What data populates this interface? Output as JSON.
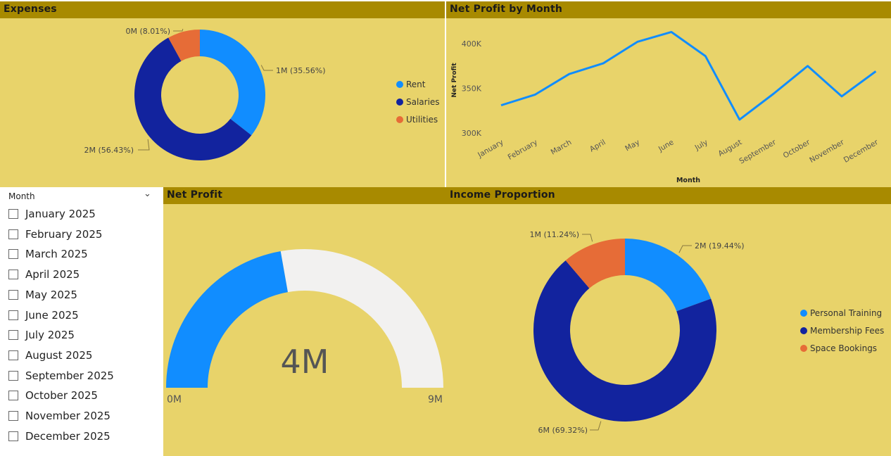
{
  "expenses": {
    "title": "Expenses",
    "legend": [
      "Rent",
      "Salaries",
      "Utilities"
    ],
    "slice_labels": [
      "1M (35.56%)",
      "2M (56.43%)",
      "0M (8.01%)"
    ]
  },
  "net_profit_by_month": {
    "title": "Net Profit by Month",
    "xlabel": "Month",
    "ylabel": "Net Profit",
    "yticks": [
      "400K",
      "350K",
      "300K"
    ],
    "months": [
      "January",
      "February",
      "March",
      "April",
      "May",
      "June",
      "July",
      "August",
      "September",
      "October",
      "November",
      "December"
    ]
  },
  "net_profit_gauge": {
    "title": "Net Profit",
    "value_label": "4M",
    "min_label": "0M",
    "max_label": "9M"
  },
  "income_proportion": {
    "title": "Income Proportion",
    "legend": [
      "Personal Training",
      "Membership Fees",
      "Space Bookings"
    ],
    "slice_labels": [
      "2M (19.44%)",
      "6M (69.32%)",
      "1M (11.24%)"
    ]
  },
  "slicer": {
    "title": "Month",
    "items": [
      "January 2025",
      "February 2025",
      "March 2025",
      "April 2025",
      "May 2025",
      "June 2025",
      "July 2025",
      "August 2025",
      "September 2025",
      "October 2025",
      "November 2025",
      "December 2025"
    ]
  },
  "colors": {
    "rent": "#118dff",
    "salaries": "#12239e",
    "utilities": "#e66c37",
    "panel_bg": "#e8d36a",
    "header_bg": "#a88a00",
    "gauge_empty": "#f2f1f0"
  },
  "chart_data": [
    {
      "type": "pie",
      "title": "Expenses",
      "categories": [
        "Rent",
        "Salaries",
        "Utilities"
      ],
      "values": [
        35.56,
        56.43,
        8.01
      ],
      "legend_position": "right"
    },
    {
      "type": "line",
      "title": "Net Profit by Month",
      "xlabel": "Month",
      "ylabel": "Net Profit",
      "x": [
        "January",
        "February",
        "March",
        "April",
        "May",
        "June",
        "July",
        "August",
        "September",
        "October",
        "November",
        "December"
      ],
      "values": [
        331000,
        343000,
        366000,
        378000,
        402000,
        413000,
        386000,
        315000,
        344000,
        375000,
        341000,
        369000
      ],
      "ylim": [
        300000,
        400000
      ],
      "grid": false
    },
    {
      "type": "gauge",
      "title": "Net Profit",
      "value": 4,
      "min": 0,
      "max": 9,
      "unit": "M"
    },
    {
      "type": "pie",
      "title": "Income Proportion",
      "categories": [
        "Personal Training",
        "Membership Fees",
        "Space Bookings"
      ],
      "values": [
        19.44,
        69.32,
        11.24
      ],
      "legend_position": "right"
    }
  ]
}
